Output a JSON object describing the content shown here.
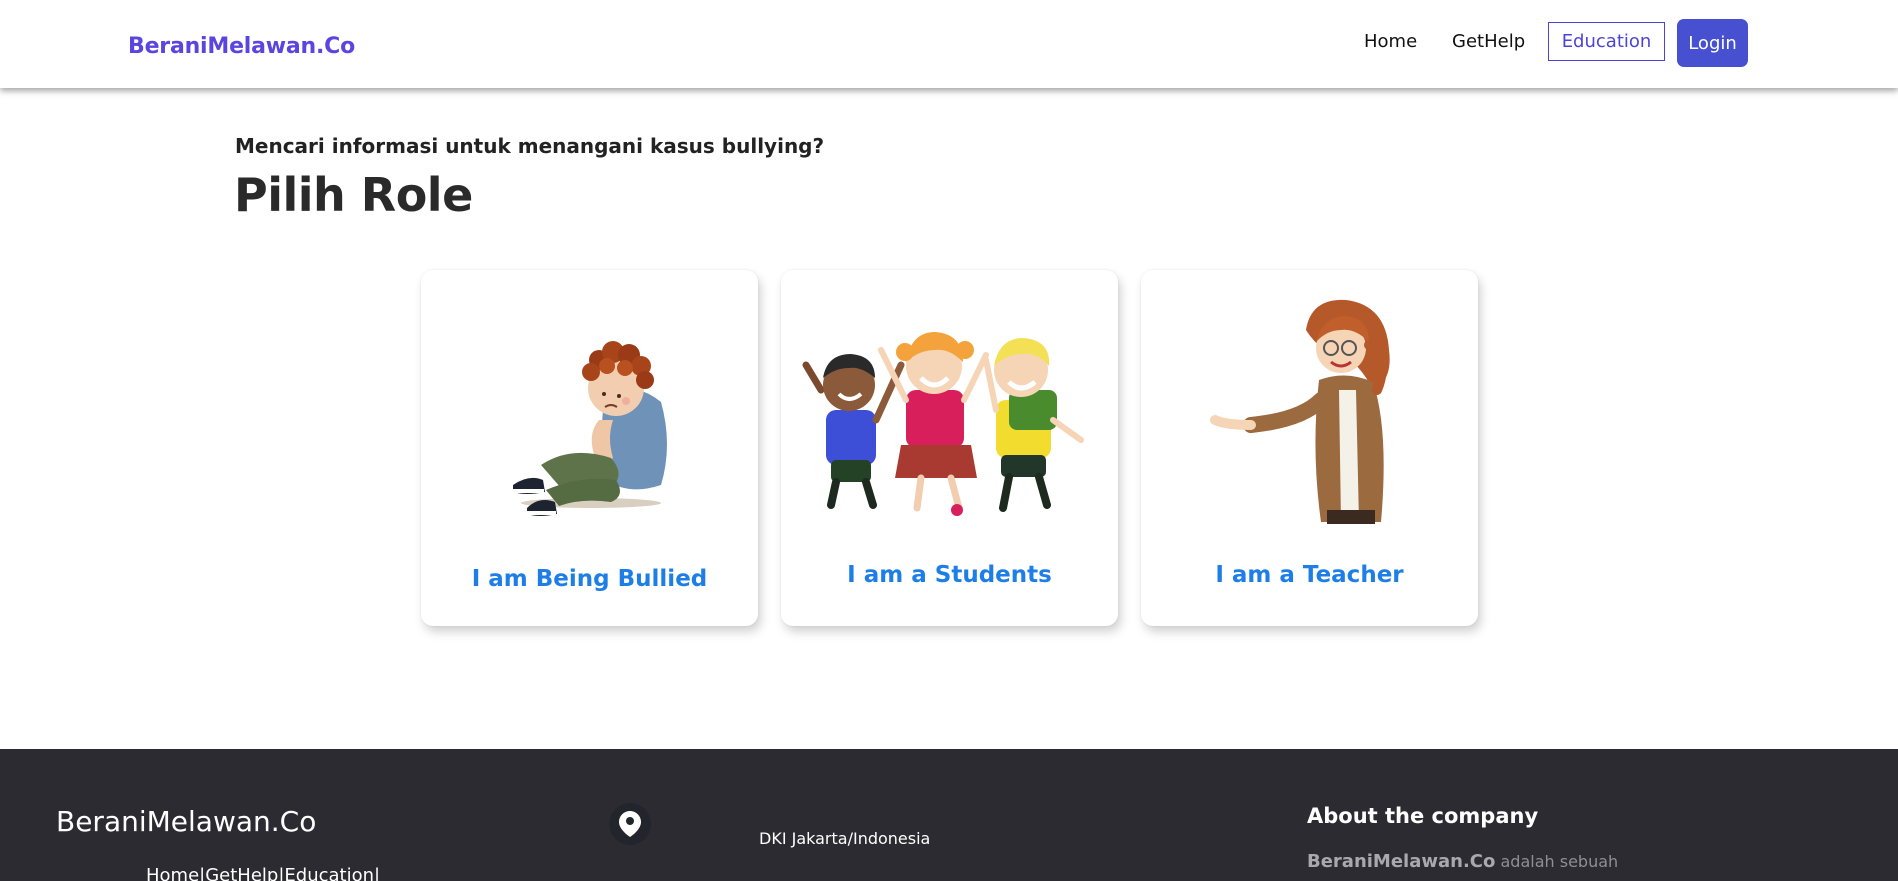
{
  "nav": {
    "brand": "BeraniMelawan.Co",
    "links": [
      "Home",
      "GetHelp"
    ],
    "education": "Education",
    "login": "Login"
  },
  "hero": {
    "subtitle": "Mencari informasi untuk menangani kasus bullying?",
    "title": "Pilih Role"
  },
  "cards": [
    {
      "label": "I am Being Bullied",
      "image": "sad-boy-illustration"
    },
    {
      "label": "I am a Students",
      "image": "happy-students-illustration"
    },
    {
      "label": "I am a Teacher",
      "image": "teacher-illustration"
    }
  ],
  "footer": {
    "brand": "BeraniMelawan.Co",
    "links": "Home|GetHelp|Education|",
    "location_icon": "map-pin-icon",
    "location": "DKI Jakarta/Indonesia",
    "about_title": "About the company",
    "about_brand": "BeraniMelawan.Co",
    "about_text": "adalah sebuah"
  },
  "colors": {
    "brand": "#5b45e0",
    "accent_button": "#4650d0",
    "card_label": "#1e7ee8",
    "footer_bg": "#2d2b32"
  }
}
